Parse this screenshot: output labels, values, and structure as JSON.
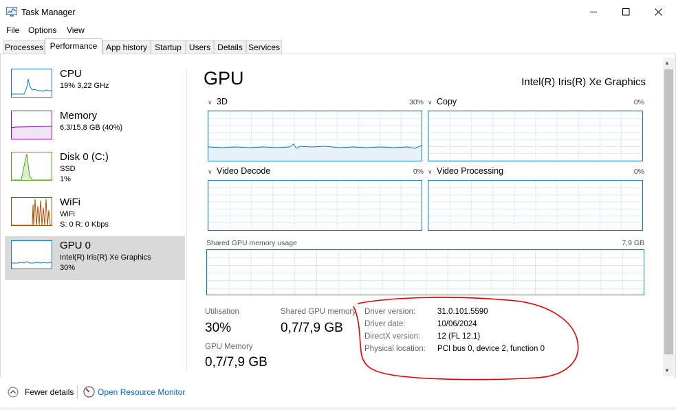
{
  "window": {
    "title": "Task Manager",
    "controls": [
      "minimize-icon",
      "maximize-icon",
      "close-icon"
    ]
  },
  "menu": [
    "File",
    "Options",
    "View"
  ],
  "tabs": [
    "Processes",
    "Performance",
    "App history",
    "Startup",
    "Users",
    "Details",
    "Services"
  ],
  "active_tab": "Performance",
  "sidebar": {
    "items": [
      {
        "title": "CPU",
        "line1": "19% 3,22 GHz",
        "line2": "",
        "color": "#1679b7"
      },
      {
        "title": "Memory",
        "line1": "6,3/15,8 GB (40%)",
        "line2": "",
        "color": "#8b12ae"
      },
      {
        "title": "Disk 0 (C:)",
        "line1": "SSD",
        "line2": "1%",
        "color": "#4da60c"
      },
      {
        "title": "WiFi",
        "line1": "WiFi",
        "line2": "S: 0 R: 0 Kbps",
        "color": "#a74f01"
      },
      {
        "title": "GPU 0",
        "line1": "Intel(R) Iris(R) Xe Graphics",
        "line2": "30%",
        "color": "#1679b7"
      }
    ],
    "selected": "GPU 0"
  },
  "main": {
    "title": "GPU",
    "gpu_name": "Intel(R) Iris(R) Xe Graphics",
    "graphs": [
      {
        "label": "3D",
        "pct": "30%"
      },
      {
        "label": "Copy",
        "pct": "0%"
      },
      {
        "label": "Video Decode",
        "pct": "0%"
      },
      {
        "label": "Video Processing",
        "pct": "0%"
      }
    ],
    "shared_memory_graph": {
      "label": "Shared GPU memory usage",
      "max": "7,9 GB"
    },
    "stats": {
      "utilisation_label": "Utilisation",
      "utilisation_value": "30%",
      "shared_label": "Shared GPU memory",
      "shared_value": "0,7/7,9 GB",
      "gpu_mem_label": "GPU Memory",
      "gpu_mem_value": "0,7/7,9 GB"
    },
    "driver": [
      {
        "label": "Driver version:",
        "value": "31.0.101.5590"
      },
      {
        "label": "Driver date:",
        "value": "10/06/2024"
      },
      {
        "label": "DirectX version:",
        "value": "12 (FL 12.1)"
      },
      {
        "label": "Physical location:",
        "value": "PCI bus 0, device 2, function 0"
      }
    ],
    "annotation_color": "#e00000"
  },
  "footer": {
    "fewer_details": "Fewer details",
    "open_monitor": "Open Resource Monitor",
    "link_color": "#0066cc"
  }
}
